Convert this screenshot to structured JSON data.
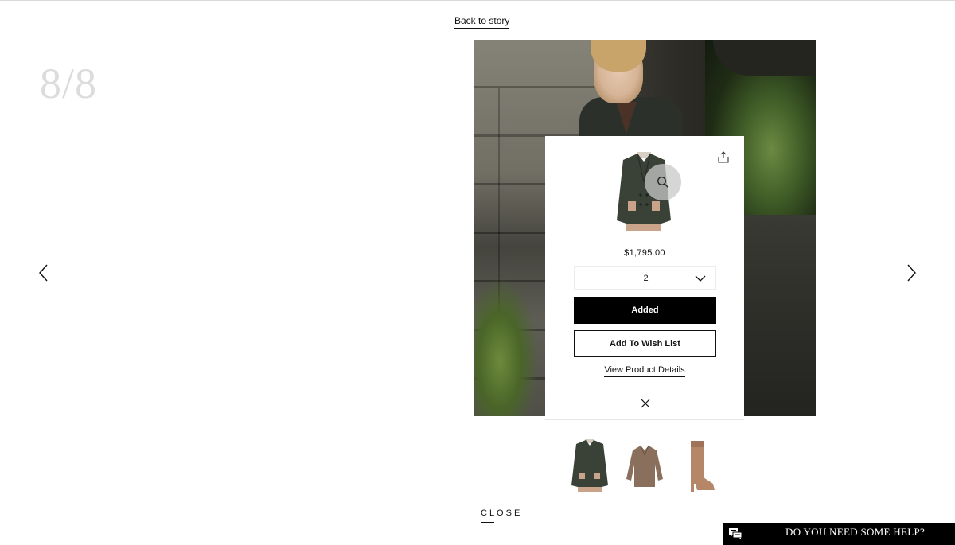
{
  "header": {
    "back_link": "Back to story"
  },
  "slideshow": {
    "counter": "8/8",
    "prev_icon": "chevron-left-icon",
    "next_icon": "chevron-right-icon"
  },
  "quick_view": {
    "price": "$1,795.00",
    "quantity": "2",
    "added_label": "Added",
    "wishlist_label": "Add To Wish List",
    "details_link": "View Product Details",
    "icons": [
      "zoom-icon",
      "share-icon",
      "close-icon",
      "chevron-down-icon"
    ]
  },
  "thumbnails": [
    {
      "item": "jacket"
    },
    {
      "item": "blouse"
    },
    {
      "item": "boot"
    }
  ],
  "footer": {
    "close_label": "CLOSE",
    "help_text": "DO YOU NEED SOME HELP?",
    "help_icon": "chat-icon"
  },
  "colors": {
    "accent": "#000000",
    "counter": "#dcdcdc",
    "jacket": "#3a4137",
    "trim": "#c9a38a"
  }
}
